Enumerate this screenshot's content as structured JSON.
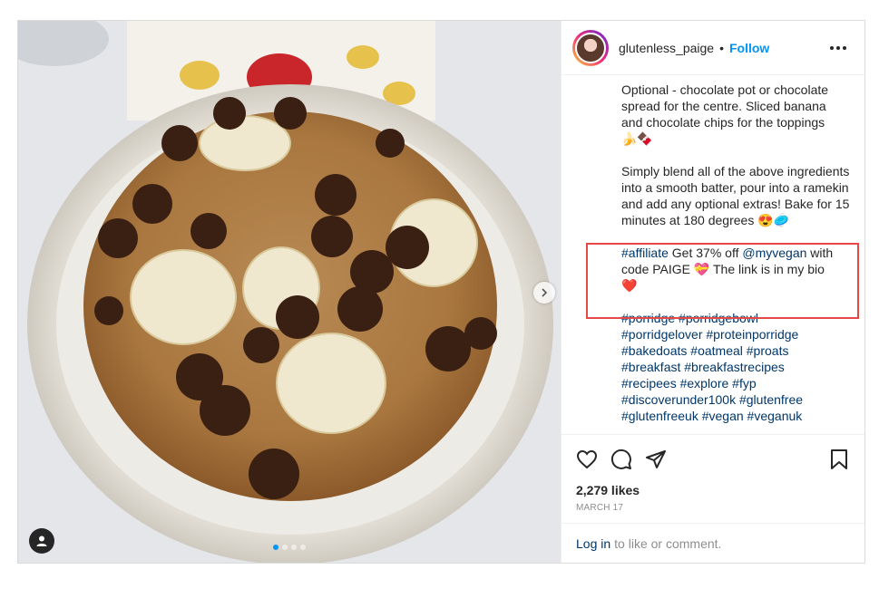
{
  "post": {
    "username": "glutenless_paige",
    "separator": "•",
    "follow_label": "Follow",
    "caption": {
      "para1": "Optional - chocolate pot or chocolate spread for the centre. Sliced banana and chocolate chips for the toppings",
      "para1_emoji": "🍌🍫",
      "para2": "Simply blend all of the above ingredients into a smooth batter, pour into a ramekin and add any optional extras! Bake for 15 minutes at 180 degrees",
      "para2_emoji": "😍🥏",
      "affiliate_tag": "#affiliate",
      "affiliate_text1": " Get 37% off ",
      "affiliate_mention": "@myvegan",
      "affiliate_text2": " with code PAIGE ",
      "affiliate_emoji1": "💝",
      "affiliate_text3": " The link is in my bio",
      "affiliate_emoji2": "❤️",
      "hashtags": [
        "#porridge #porridgebowl",
        "#porridgelover #proteinporridge",
        "#bakedoats #oatmeal #proats",
        "#breakfast #breakfastrecipes",
        "#recipees #explore #fyp",
        "#discoverunder100k #glutenfree",
        "#glutenfreeuk #vegan #veganuk"
      ]
    },
    "likes": "2,279 likes",
    "date": "MARCH 17",
    "login_link": "Log in",
    "login_text": "to like or comment."
  },
  "icons": {
    "like": "heart-icon",
    "comment": "comment-icon",
    "share": "share-icon",
    "save": "bookmark-icon",
    "more": "more-options-icon",
    "next": "chevron-right-icon",
    "user_tag": "user-tag-icon"
  },
  "carousel": {
    "current": 1,
    "total": 4
  },
  "colors": {
    "accent": "#0095f6",
    "link": "#00376b",
    "highlight_box": "#e64848"
  }
}
